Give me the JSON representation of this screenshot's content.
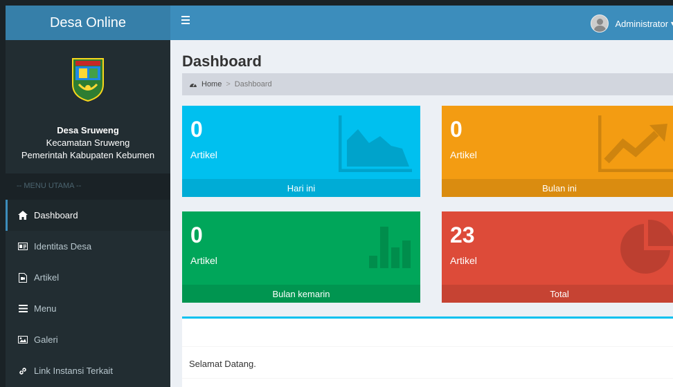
{
  "app": {
    "brand": "Desa Online"
  },
  "profile": {
    "village": "Desa Sruweng",
    "district": "Kecamatan Sruweng",
    "regency": "Pemerintah Kabupaten Kebumen"
  },
  "sidebar": {
    "header": "-- MENU UTAMA --",
    "items": [
      {
        "label": "Dashboard",
        "icon": "home-icon",
        "active": true
      },
      {
        "label": "Identitas Desa",
        "icon": "id-card-icon",
        "active": false
      },
      {
        "label": "Artikel",
        "icon": "file-icon",
        "active": false
      },
      {
        "label": "Menu",
        "icon": "bars-icon",
        "active": false
      },
      {
        "label": "Galeri",
        "icon": "image-icon",
        "active": false
      },
      {
        "label": "Link Instansi Terkait",
        "icon": "link-icon",
        "active": false
      }
    ]
  },
  "topbar": {
    "user": "Administrator"
  },
  "page": {
    "title": "Dashboard",
    "breadcrumb": {
      "home": "Home",
      "separator": ">",
      "current": "Dashboard"
    }
  },
  "stats": [
    {
      "value": "0",
      "label": "Artikel",
      "footer": "Hari ini",
      "color": "#00c0ef",
      "icon": "area-chart-icon"
    },
    {
      "value": "0",
      "label": "Artikel",
      "footer": "Bulan ini",
      "color": "#f39c12",
      "icon": "line-chart-icon"
    },
    {
      "value": "0",
      "label": "Artikel",
      "footer": "Bulan kemarin",
      "color": "#00a65a",
      "icon": "bar-chart-icon"
    },
    {
      "value": "23",
      "label": "Artikel",
      "footer": "Total",
      "color": "#dd4b39",
      "icon": "pie-chart-icon"
    }
  ],
  "welcome": {
    "text": "Selamat Datang."
  }
}
